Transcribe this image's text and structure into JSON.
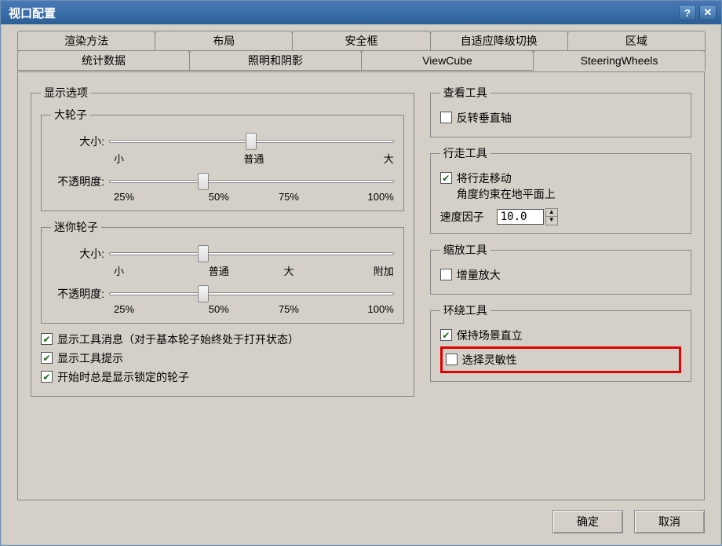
{
  "title": "视口配置",
  "tabs_row1": [
    "渲染方法",
    "布局",
    "安全框",
    "自适应降级切换",
    "区域"
  ],
  "tabs_row2": [
    "统计数据",
    "照明和阴影",
    "ViewCube",
    "SteeringWheels"
  ],
  "active_tab": "SteeringWheels",
  "display_options": {
    "legend": "显示选项",
    "big_wheel": {
      "legend": "大轮子",
      "size_label": "大小:",
      "size_ticks": [
        "小",
        "普通",
        "大"
      ],
      "size_value": 50,
      "opacity_label": "不透明度:",
      "opacity_ticks": [
        "25%",
        "50%",
        "75%",
        "100%"
      ],
      "opacity_value": 33
    },
    "mini_wheel": {
      "legend": "迷你轮子",
      "size_label": "大小:",
      "size_ticks": [
        "小",
        "普通",
        "大",
        "附加"
      ],
      "size_value": 33,
      "opacity_label": "不透明度:",
      "opacity_ticks": [
        "25%",
        "50%",
        "75%",
        "100%"
      ],
      "opacity_value": 33
    },
    "checks": {
      "show_tool_msg": {
        "label": "显示工具消息（对于基本轮子始终处于打开状态）",
        "checked": true
      },
      "show_tool_tip": {
        "label": "显示工具提示",
        "checked": true
      },
      "start_show_locked": {
        "label": "开始时总是显示锁定的轮子",
        "checked": true
      }
    }
  },
  "look_tool": {
    "legend": "查看工具",
    "invert_vaxis": {
      "label": "反转垂直轴",
      "checked": false
    }
  },
  "walk_tool": {
    "legend": "行走工具",
    "constrain": {
      "label": "将行走移动\n角度约束在地平面上",
      "checked": true
    },
    "speed_label": "速度因子",
    "speed_value": "10.0"
  },
  "zoom_tool": {
    "legend": "缩放工具",
    "incremental": {
      "label": "增量放大",
      "checked": false
    }
  },
  "orbit_tool": {
    "legend": "环绕工具",
    "keep_upright": {
      "label": "保持场景直立",
      "checked": true
    },
    "select_sensitivity": {
      "label": "选择灵敏性",
      "checked": false
    }
  },
  "buttons": {
    "ok": "确定",
    "cancel": "取消"
  }
}
